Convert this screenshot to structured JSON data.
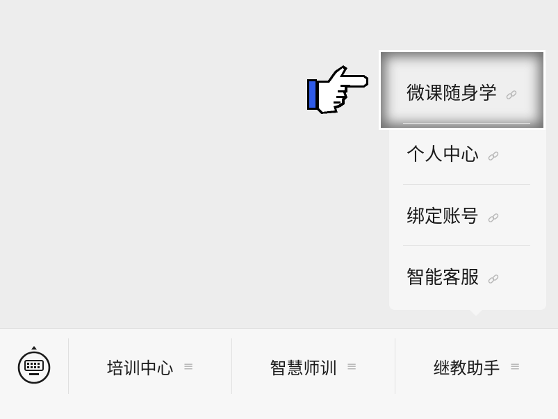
{
  "popup_menu": {
    "items": [
      {
        "label": "微课随身学",
        "icon": "link-icon"
      },
      {
        "label": "个人中心",
        "icon": "link-icon"
      },
      {
        "label": "绑定账号",
        "icon": "link-icon"
      },
      {
        "label": "智能客服",
        "icon": "link-icon"
      }
    ]
  },
  "menubar": {
    "keyboard_icon": "keyboard-icon",
    "items": [
      {
        "label": "培训中心",
        "icon": "≡"
      },
      {
        "label": "智慧师训",
        "icon": "≡"
      },
      {
        "label": "继教助手",
        "icon": "≡"
      }
    ]
  },
  "colors": {
    "background": "#ededed",
    "menu_bg": "#f6f6f6",
    "text": "#1a1a1a",
    "hand_cuff": "#2f5be8"
  }
}
